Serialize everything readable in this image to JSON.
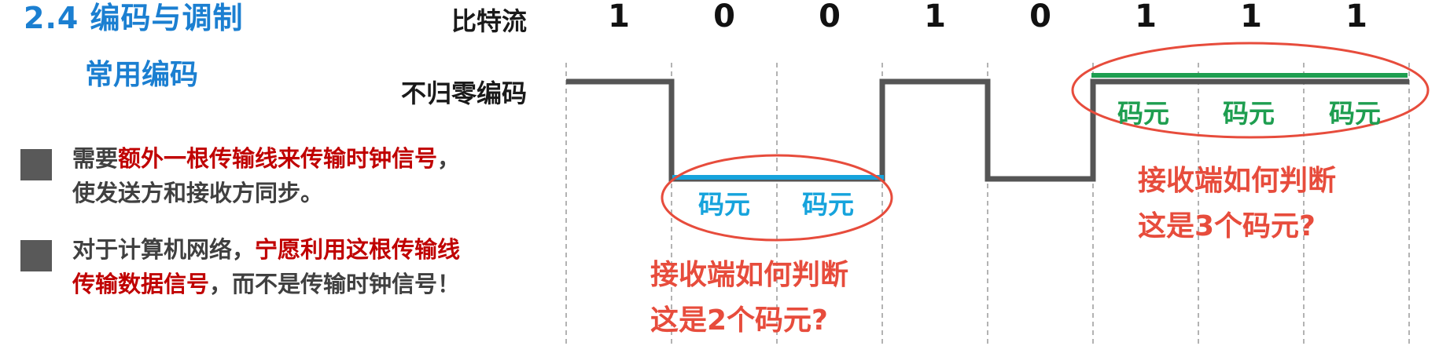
{
  "title": "2.4 编码与调制",
  "subtitle": "常用编码",
  "bullets": [
    {
      "line1_normal": "需要",
      "line1_red": "额外一根传输线来传输时钟信号",
      "line1_tail": "，",
      "line2": "使发送方和接收方同步。"
    },
    {
      "line1_normal": "对于计算机网络，",
      "line1_red": "宁愿利用这根传输线",
      "line2_red": "传输数据信号",
      "line2_tail": "，而不是传输时钟信号！"
    }
  ],
  "labels": {
    "bitstream": "比特流",
    "nrz": "不归零编码"
  },
  "bits": [
    "1",
    "0",
    "0",
    "1",
    "0",
    "1",
    "1",
    "1"
  ],
  "annotations": {
    "symbol": "码元",
    "q1_line1": "接收端如何判断",
    "q1_line2": "这是2个码元?",
    "q2_line1": "接收端如何判断",
    "q2_line2": "这是3个码元?"
  },
  "colors": {
    "title": "#1b7fd1",
    "red_text": "#c00000",
    "annotation_red": "#e74c3c",
    "blue": "#16a3dc",
    "green": "#1e9e50",
    "waveform": "#555555"
  },
  "diagram": {
    "type": "nrz-waveform",
    "bits": [
      1,
      0,
      0,
      1,
      0,
      1,
      1,
      1
    ],
    "highlight_blue_bits": [
      1,
      2
    ],
    "highlight_green_bits": [
      5,
      6,
      7
    ]
  }
}
